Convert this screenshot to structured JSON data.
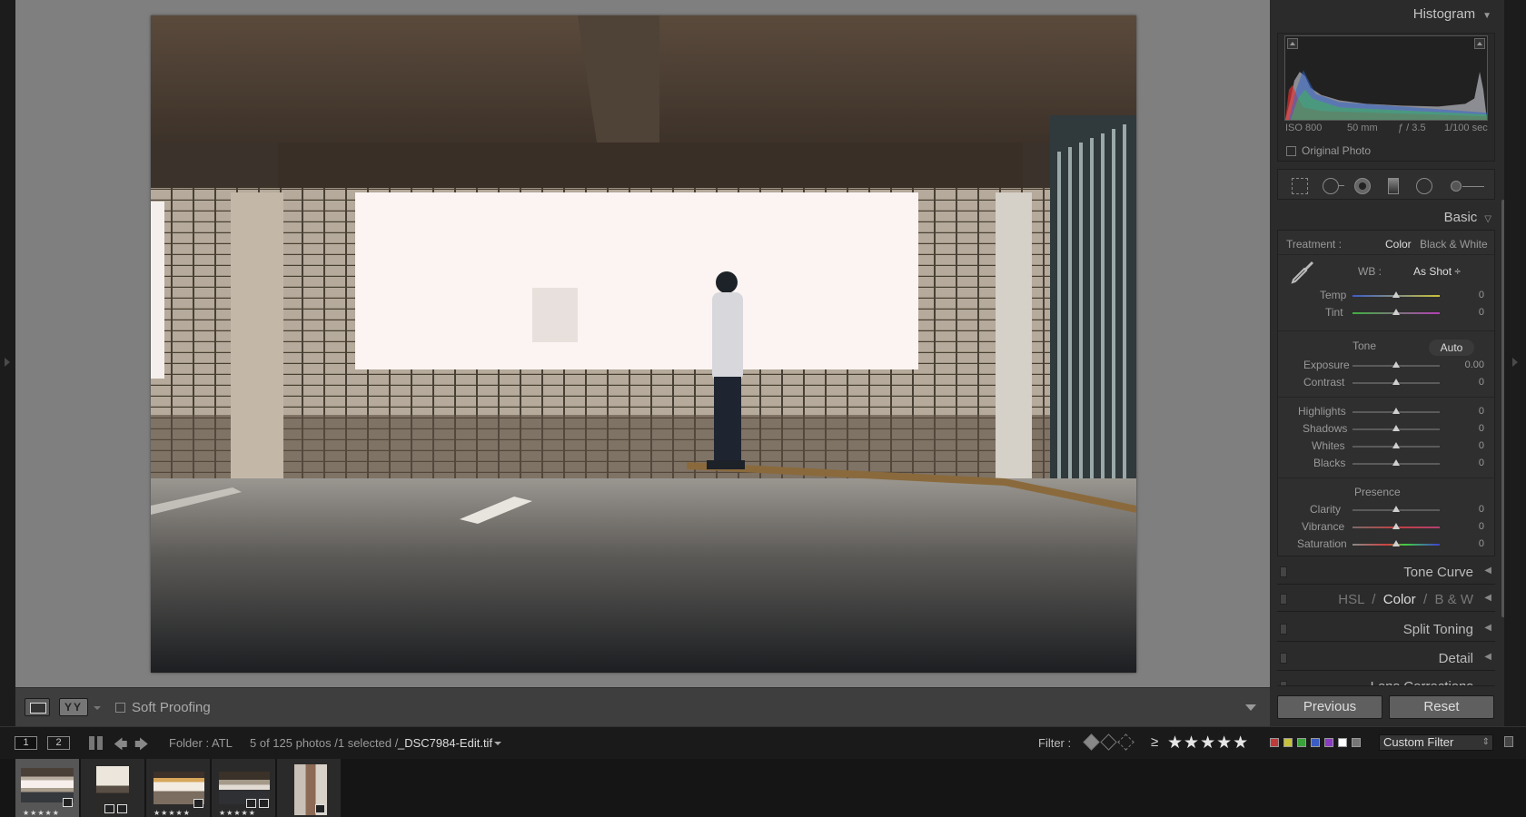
{
  "histogram": {
    "title": "Histogram",
    "iso": "ISO 800",
    "focal": "50 mm",
    "aperture": "ƒ / 3.5",
    "shutter": "1/100 sec",
    "original_photo": "Original Photo"
  },
  "basic": {
    "title": "Basic",
    "treatment_label": "Treatment :",
    "treatment_color": "Color",
    "treatment_bw": "Black & White",
    "wb_label": "WB :",
    "wb_value": "As Shot ÷",
    "tone_label": "Tone",
    "auto_label": "Auto",
    "presence_label": "Presence",
    "sliders": {
      "temp": {
        "label": "Temp",
        "value": "0"
      },
      "tint": {
        "label": "Tint",
        "value": "0"
      },
      "exposure": {
        "label": "Exposure",
        "value": "0.00"
      },
      "contrast": {
        "label": "Contrast",
        "value": "0"
      },
      "highlights": {
        "label": "Highlights",
        "value": "0"
      },
      "shadows": {
        "label": "Shadows",
        "value": "0"
      },
      "whites": {
        "label": "Whites",
        "value": "0"
      },
      "blacks": {
        "label": "Blacks",
        "value": "0"
      },
      "clarity": {
        "label": "Clarity",
        "value": "0"
      },
      "vibrance": {
        "label": "Vibrance",
        "value": "0"
      },
      "saturation": {
        "label": "Saturation",
        "value": "0"
      }
    }
  },
  "panels": {
    "tone_curve": "Tone Curve",
    "hsl": "HSL",
    "hsl_sep1": "/",
    "color": "Color",
    "hsl_sep2": "/",
    "bw": "B & W",
    "split_toning": "Split Toning",
    "detail": "Detail",
    "lens": "Lens Corrections"
  },
  "buttons": {
    "previous": "Previous",
    "reset": "Reset"
  },
  "toolbar": {
    "view_yy": "YY",
    "soft_proofing": "Soft Proofing"
  },
  "filmstrip_bar": {
    "screen1": "1",
    "screen2": "2",
    "folder": "Folder : ATL",
    "count": "5 of 125 photos /1 selected /",
    "file": "_DSC7984-Edit.tif",
    "filter_label": "Filter :",
    "ge": "≥",
    "stars": "★★★★★",
    "custom_filter": "Custom Filter",
    "color_labels": [
      "#c23b3b",
      "#c8c23b",
      "#3ba23b",
      "#3b5cc2",
      "#8a3bc2",
      "#ffffff",
      "#777777"
    ]
  },
  "thumbs": [
    {
      "stars": "★★★★★",
      "selected": true
    },
    {
      "stars": "",
      "selected": false
    },
    {
      "stars": "★★★★★",
      "selected": false
    },
    {
      "stars": "★★★★★",
      "selected": false
    },
    {
      "stars": "",
      "selected": false
    }
  ]
}
